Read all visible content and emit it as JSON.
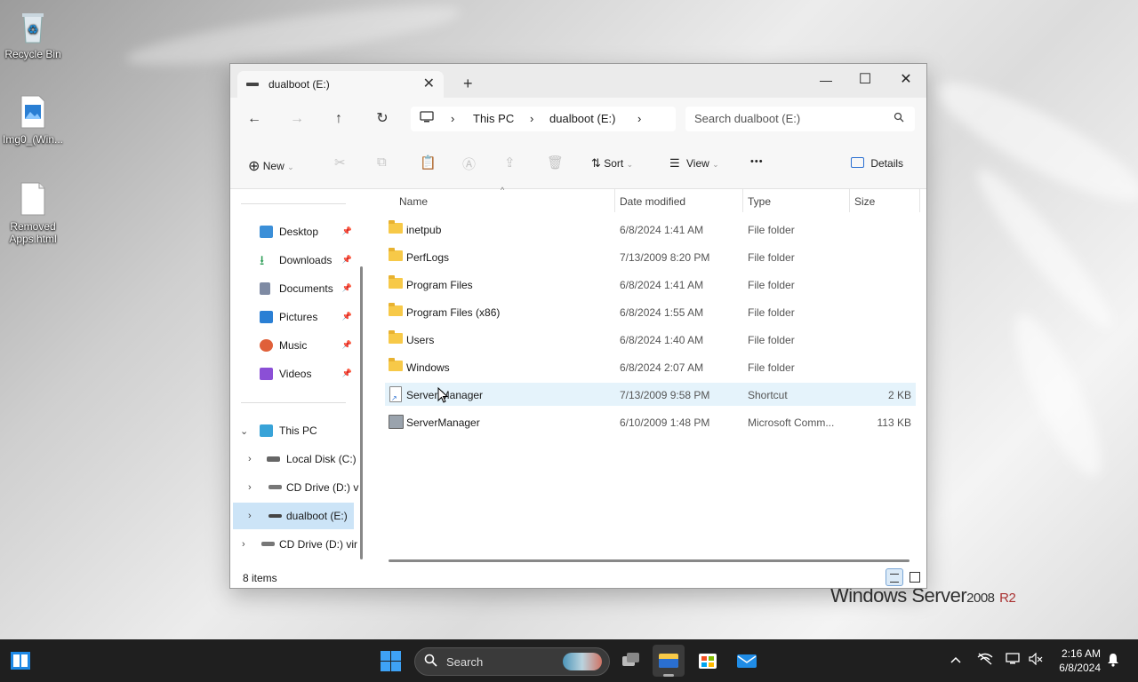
{
  "desktop": {
    "icons": [
      {
        "label": "Recycle Bin"
      },
      {
        "label": "Img0_(Win..."
      },
      {
        "label": "Removed Apps.html"
      }
    ],
    "branding": {
      "text": "Windows Server",
      "version": "2008",
      "suffix": "R2"
    }
  },
  "window": {
    "tab": {
      "label": "dualboot (E:)",
      "close": "✕"
    },
    "new_tab": "+",
    "controls": {
      "minimize": "—",
      "maximize": "☐",
      "close": "✕"
    },
    "nav": {
      "back": "←",
      "forward": "→",
      "up": "↑",
      "refresh": "↻"
    },
    "breadcrumb": {
      "root_icon": "monitor-icon",
      "items": [
        "This PC",
        "dualboot (E:)"
      ],
      "separator": "›"
    },
    "search": {
      "placeholder": "Search dualboot (E:)"
    },
    "commandbar": {
      "new_label": "New",
      "sort_label": "Sort",
      "view_label": "View",
      "more": "•••",
      "details_label": "Details"
    },
    "sidebar": {
      "quick_access": [
        {
          "label": "Desktop",
          "icon": "desktop-icon",
          "color": "#3b8fd8"
        },
        {
          "label": "Downloads",
          "icon": "download-icon",
          "color": "#2e9d57"
        },
        {
          "label": "Documents",
          "icon": "documents-icon",
          "color": "#7e8aa3"
        },
        {
          "label": "Pictures",
          "icon": "pictures-icon",
          "color": "#2a7fd4"
        },
        {
          "label": "Music",
          "icon": "music-icon",
          "color": "#e0603a"
        },
        {
          "label": "Videos",
          "icon": "videos-icon",
          "color": "#8b4fd6"
        }
      ],
      "pin": "📌",
      "this_pc": "This PC",
      "drives": [
        {
          "label": "Local Disk (C:)"
        },
        {
          "label": "CD Drive (D:) v"
        },
        {
          "label": "dualboot (E:)",
          "selected": true
        },
        {
          "label": "CD Drive (D:) vir"
        }
      ]
    },
    "columns": {
      "name": "Name",
      "date": "Date modified",
      "type": "Type",
      "size": "Size"
    },
    "files": [
      {
        "name": "inetpub",
        "date": "6/8/2024 1:41 AM",
        "type": "File folder",
        "size": ""
      },
      {
        "name": "PerfLogs",
        "date": "7/13/2009 8:20 PM",
        "type": "File folder",
        "size": ""
      },
      {
        "name": "Program Files",
        "date": "6/8/2024 1:41 AM",
        "type": "File folder",
        "size": ""
      },
      {
        "name": "Program Files (x86)",
        "date": "6/8/2024 1:55 AM",
        "type": "File folder",
        "size": ""
      },
      {
        "name": "Users",
        "date": "6/8/2024 1:40 AM",
        "type": "File folder",
        "size": ""
      },
      {
        "name": "Windows",
        "date": "6/8/2024 2:07 AM",
        "type": "File folder",
        "size": ""
      },
      {
        "name": "Server Manager",
        "date": "7/13/2009 9:58 PM",
        "type": "Shortcut",
        "size": "2 KB"
      },
      {
        "name": "ServerManager",
        "date": "6/10/2009 1:48 PM",
        "type": "Microsoft Comm...",
        "size": "113 KB"
      }
    ],
    "status": {
      "count": "8 items"
    }
  },
  "taskbar": {
    "search_label": "Search",
    "clock": {
      "time": "2:16 AM",
      "date": "6/8/2024"
    }
  }
}
